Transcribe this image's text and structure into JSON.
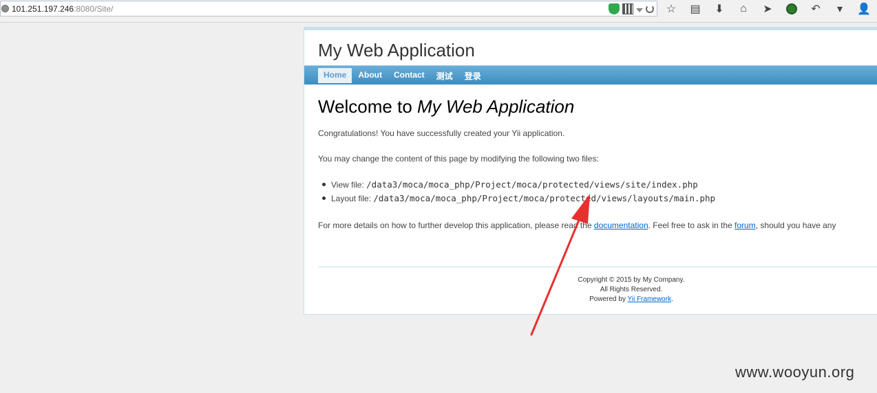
{
  "browser": {
    "url_host": "101.251.197.246",
    "url_rest": ":8080/Site/",
    "buttons": [
      "bookmark-star",
      "reading-list",
      "download",
      "home",
      "send",
      "addon",
      "undo",
      "menu-dropdown",
      "account",
      "extension"
    ]
  },
  "site": {
    "title": "My Web Application",
    "menu": [
      "Home",
      "About",
      "Contact",
      "测试",
      "登录"
    ]
  },
  "content": {
    "heading_prefix": "Welcome to ",
    "heading_app": "My Web Application",
    "congrats": "Congratulations! You have successfully created your Yii application.",
    "change_text": "You may change the content of this page by modifying the following two files:",
    "view_label": "View file: ",
    "view_path": "/data3/moca/moca_php/Project/moca/protected/views/site/index.php",
    "layout_label": "Layout file: ",
    "layout_path": "/data3/moca/moca_php/Project/moca/protected/views/layouts/main.php",
    "details_before": "For more details on how to further develop this application, please read the ",
    "documentation": "documentation",
    "details_middle": ". Feel free to ask in the ",
    "forum": "forum",
    "details_after": ", should you have any"
  },
  "footer": {
    "copyright": "Copyright © 2015 by My Company.",
    "rights": "All Rights Reserved.",
    "powered_prefix": "Powered by ",
    "powered_link": "Yii Framework",
    "powered_suffix": "."
  },
  "watermark": "www.wooyun.org",
  "colors": {
    "menu_bar": "#4a9bcd",
    "arrow": "#e8302f",
    "link": "#0066cc"
  }
}
